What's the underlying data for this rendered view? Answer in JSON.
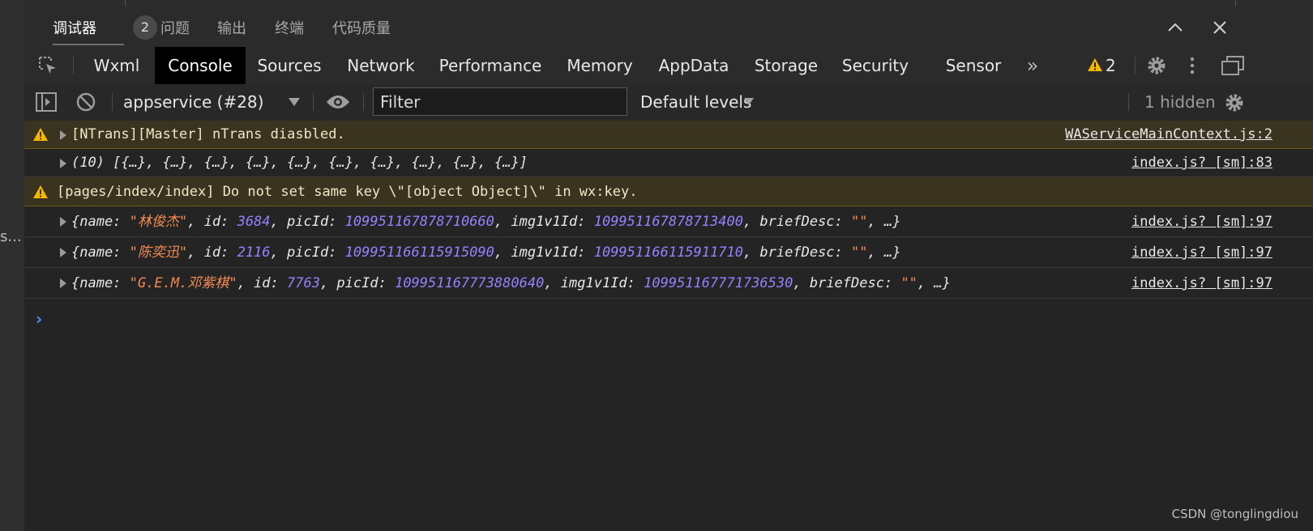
{
  "left_strip": {
    "truncated_text": "s..."
  },
  "debugger": {
    "tabs": [
      {
        "label": "调试器",
        "badge": "2"
      },
      {
        "label": "问题"
      },
      {
        "label": "输出"
      },
      {
        "label": "终端"
      },
      {
        "label": "代码质量"
      }
    ]
  },
  "devtools": {
    "tabs": [
      "Wxml",
      "Console",
      "Sources",
      "Network",
      "Performance",
      "Memory",
      "AppData",
      "Storage",
      "Security",
      "Sensor"
    ],
    "active_tab": "Console",
    "more_label": "»",
    "warning_count": "2"
  },
  "toolbar": {
    "context": "appservice (#28)",
    "filter_placeholder": "Filter",
    "levels": "Default levels",
    "hidden": "1 hidden"
  },
  "console": {
    "rows": [
      {
        "type": "warning",
        "text": "[NTrans][Master] nTrans diasbled.",
        "source": "WAServiceMainContext.js:2"
      },
      {
        "type": "log",
        "text": "(10) [{…}, {…}, {…}, {…}, {…}, {…}, {…}, {…}, {…}, {…}]",
        "source": "index.js? [sm]:83"
      },
      {
        "type": "warning",
        "text": "[pages/index/index] Do not set same key \\\"[object Object]\\\" in wx:key.",
        "source": ""
      },
      {
        "type": "object",
        "name": "林俊杰",
        "id": "3684",
        "picId": "109951167878710660",
        "img1v1Id": "109951167878713400",
        "source": "index.js? [sm]:97"
      },
      {
        "type": "object",
        "name": "陈奕迅",
        "id": "2116",
        "picId": "109951166115915090",
        "img1v1Id": "109951166115911710",
        "source": "index.js? [sm]:97"
      },
      {
        "type": "object",
        "name": "G.E.M.邓紫棋",
        "id": "7763",
        "picId": "109951167773880640",
        "img1v1Id": "109951167771736530",
        "source": "index.js? [sm]:97"
      }
    ],
    "prompt": "›"
  },
  "watermark": "CSDN @tonglingdiou",
  "colors": {
    "warning_bg": "#3a3320",
    "string": "#f28b54",
    "number": "#9980ff",
    "prompt": "#4c8ff7"
  }
}
